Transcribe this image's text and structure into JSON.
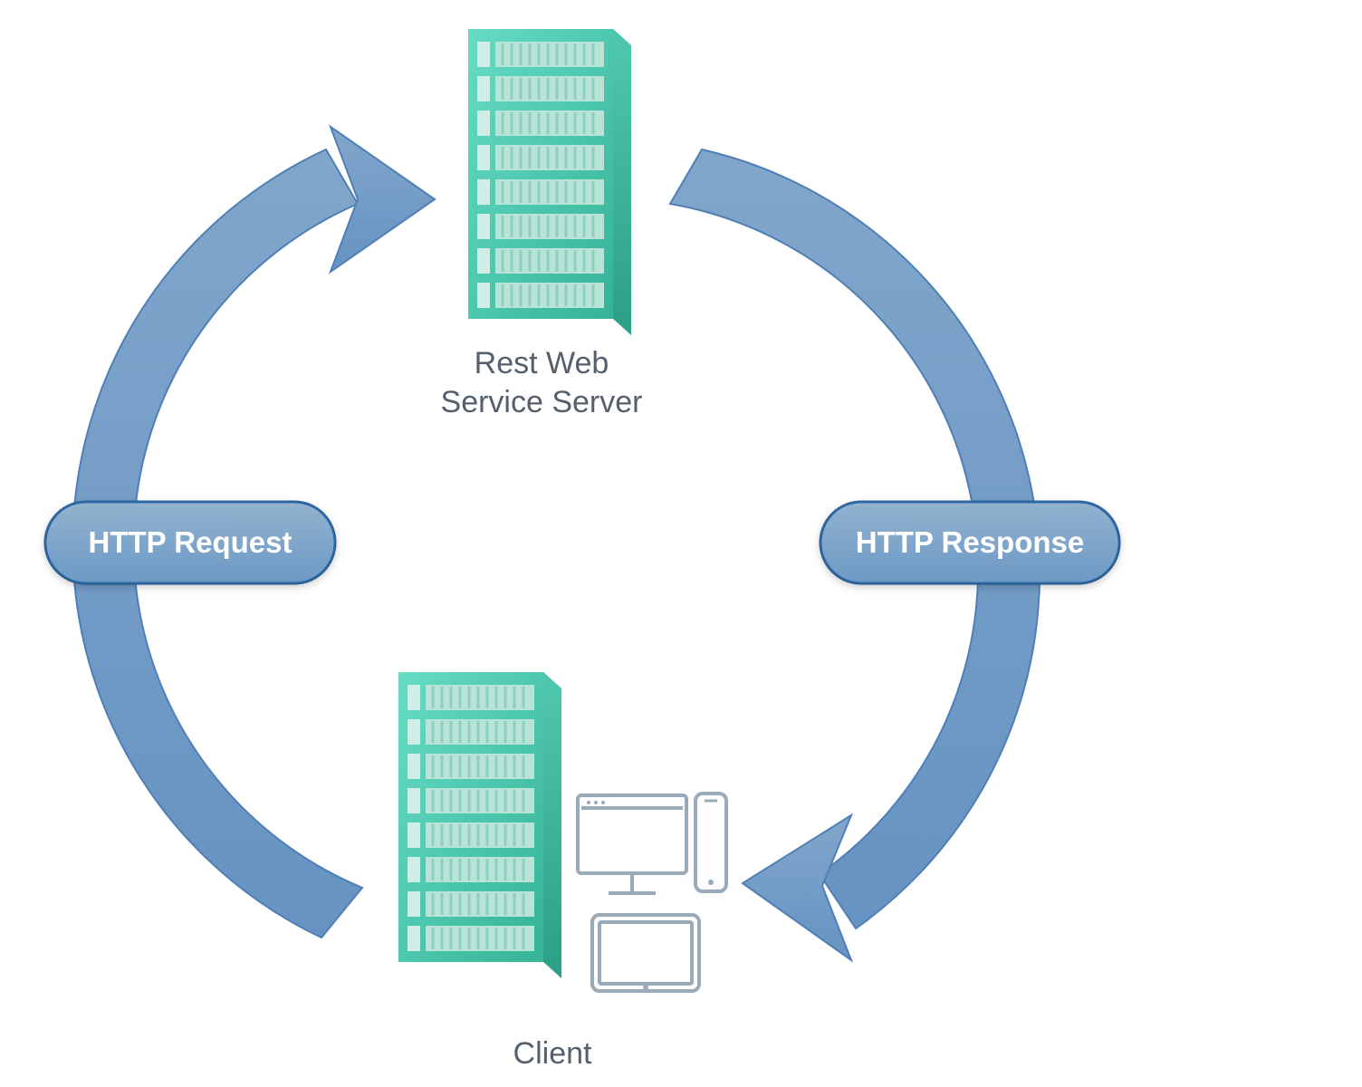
{
  "diagram": {
    "server_label": "Rest Web Service Server",
    "client_label": "Client",
    "request_pill": "HTTP Request",
    "response_pill": "HTTP Response"
  },
  "colors": {
    "arrow_start": "#79a0c9",
    "arrow_end": "#6a95c4",
    "arrow_stroke": "#4f7fb6",
    "pill_fill1": "#8fb0ce",
    "pill_fill2": "#6f9bc6",
    "pill_stroke": "#2f6aa8",
    "server_a": "#5ed7bf",
    "server_b": "#39b79b",
    "server_side": "#2fa58c",
    "rack_light": "#cce8e2",
    "rack_dark": "#9bd4c6",
    "device_stroke": "#96a6b5",
    "device_fill": "#fdfdff",
    "text": "#55606c"
  }
}
